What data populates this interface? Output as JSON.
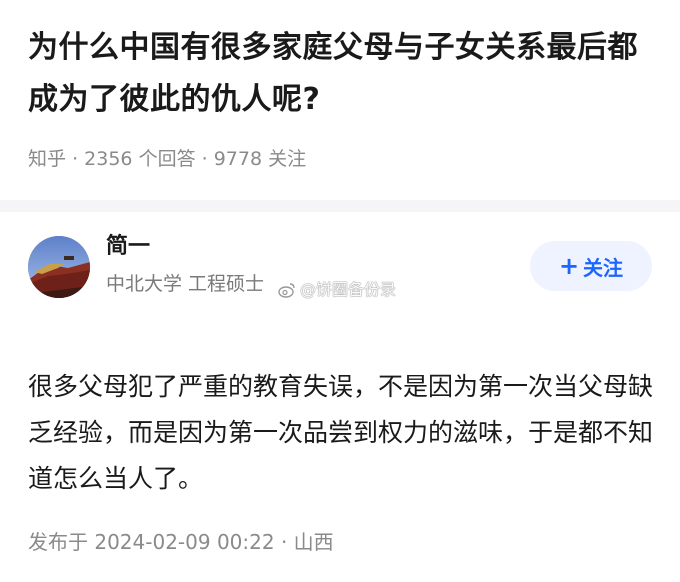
{
  "question": {
    "title": "为什么中国有很多家庭父母与子女关系最后都成为了彼此的仇人呢?",
    "site": "知乎",
    "answer_count": "2356",
    "answer_label": "个回答",
    "follower_count": "9778",
    "follower_label": "关注",
    "separator": "·"
  },
  "answer": {
    "author_name": "简一",
    "author_headline": "中北大学 工程硕士",
    "follow_label": "关注",
    "follow_icon": "plus-icon",
    "body": "很多父母犯了严重的教育失误，不是因为第一次当父母缺乏经验，而是因为第一次品尝到权力的滋味，于是都不知道怎么当人了。",
    "published": "发布于 2024-02-09 00:22 · 山西"
  },
  "watermark": {
    "text": "@饼圈备份录",
    "icon": "weibo-icon"
  },
  "colors": {
    "accent": "#1a66ff",
    "follow_bg": "#eef3ff",
    "meta_text": "#8a8a8a",
    "divider": "#f5f5f7"
  }
}
